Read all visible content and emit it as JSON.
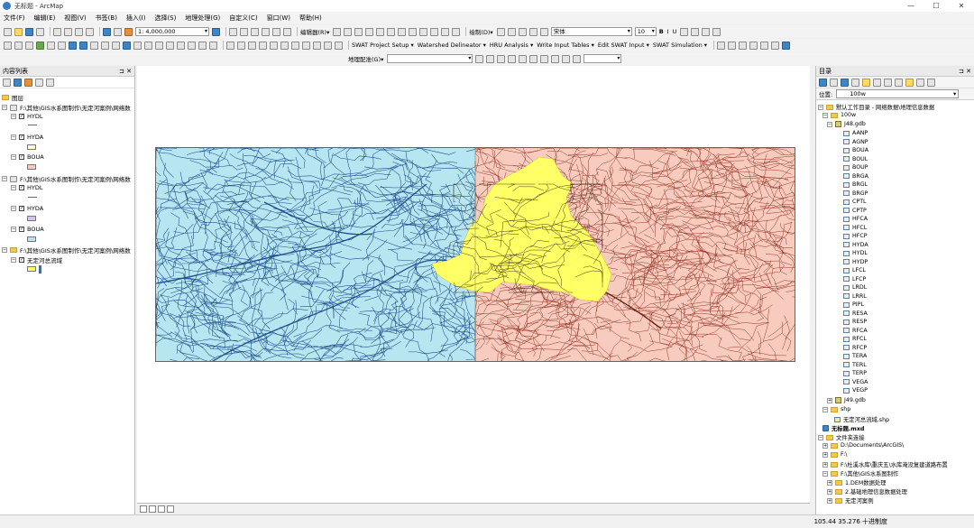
{
  "window": {
    "title": "无标题 - ArcMap",
    "min": "—",
    "max": "☐",
    "close": "✕"
  },
  "menu": [
    "文件(F)",
    "编辑(E)",
    "视图(V)",
    "书签(B)",
    "插入(I)",
    "选择(S)",
    "地理处理(G)",
    "自定义(C)",
    "窗口(W)",
    "帮助(H)"
  ],
  "toolbar1": {
    "scale": "1: 4,000,000",
    "editor": "编辑器(R)▾",
    "draw": "绘制(D)▾",
    "font": "宋体",
    "fontsize": "10",
    "bold": "B",
    "italic": "I",
    "underline": "U"
  },
  "toolbar2": {
    "swat": [
      "SWAT Project Setup ▾",
      "Watershed Delineator ▾",
      "HRU Analysis ▾",
      "Write Input Tables ▾",
      "Edit SWAT Input ▾",
      "SWAT Simulation ▾"
    ]
  },
  "toolbar3": {
    "georef": "地理配准(G)▾"
  },
  "toc": {
    "title": "内容列表",
    "root": "图层",
    "groups": [
      {
        "path": "F:\\其他\\GIS水系图制作\\无定河案例\\网络数",
        "layers": [
          "HYDL",
          "HYDA",
          "BOUA"
        ]
      },
      {
        "path": "F:\\其他\\GIS水系图制作\\无定河案例\\网络数",
        "layers": [
          "HYDL",
          "HYDA",
          "BOUA"
        ]
      },
      {
        "path": "F:\\其他\\GIS水系图制作\\无定河案例\\网络数",
        "layers": [
          "无定河总流域"
        ]
      }
    ]
  },
  "catalog": {
    "title": "目录",
    "location_label": "位置:",
    "location_value": "100w",
    "home": "默认工作目录 - 网络数据\\地理信息数据",
    "folder_100w": "100w",
    "gdb1": "J48.gdb",
    "features": [
      "AANP",
      "AGNP",
      "BOUA",
      "BOUL",
      "BOUP",
      "BRGA",
      "BRGL",
      "BRGP",
      "CPTL",
      "CPTP",
      "HFCA",
      "HFCL",
      "HFCP",
      "HYDA",
      "HYDL",
      "HYDP",
      "LFCL",
      "LFCP",
      "LRDL",
      "LRRL",
      "PIPL",
      "RESA",
      "RESP",
      "RFCA",
      "RFCL",
      "RFCP",
      "TERA",
      "TERL",
      "TERP",
      "VEGA",
      "VEGP"
    ],
    "gdb2": "J49.gdb",
    "shp_folder": "shp",
    "shp_file": "无定河总流域.shp",
    "mxd": "无标题.mxd",
    "connections": "文件夹连接",
    "conn_items": [
      "D:\\Documents\\ArcGIS\\",
      "F:\\",
      "F:\\杜溪水库\\重庆五\\水库淹没复建道路布置",
      "F:\\其他\\GIS水系图制作"
    ],
    "sub_items": [
      "1.DEM数据处理",
      "2.基础地理信息数据处理",
      "无定河案例"
    ]
  },
  "status": {
    "coords": "105.44  35.276 十进制度"
  },
  "colors": {
    "blue_region": "#b8e6f0",
    "pink_region": "#f8cbbf",
    "yellow_basin": "#ffff66",
    "blue_river": "#1f4e8c",
    "red_river": "#8b2a1a"
  }
}
